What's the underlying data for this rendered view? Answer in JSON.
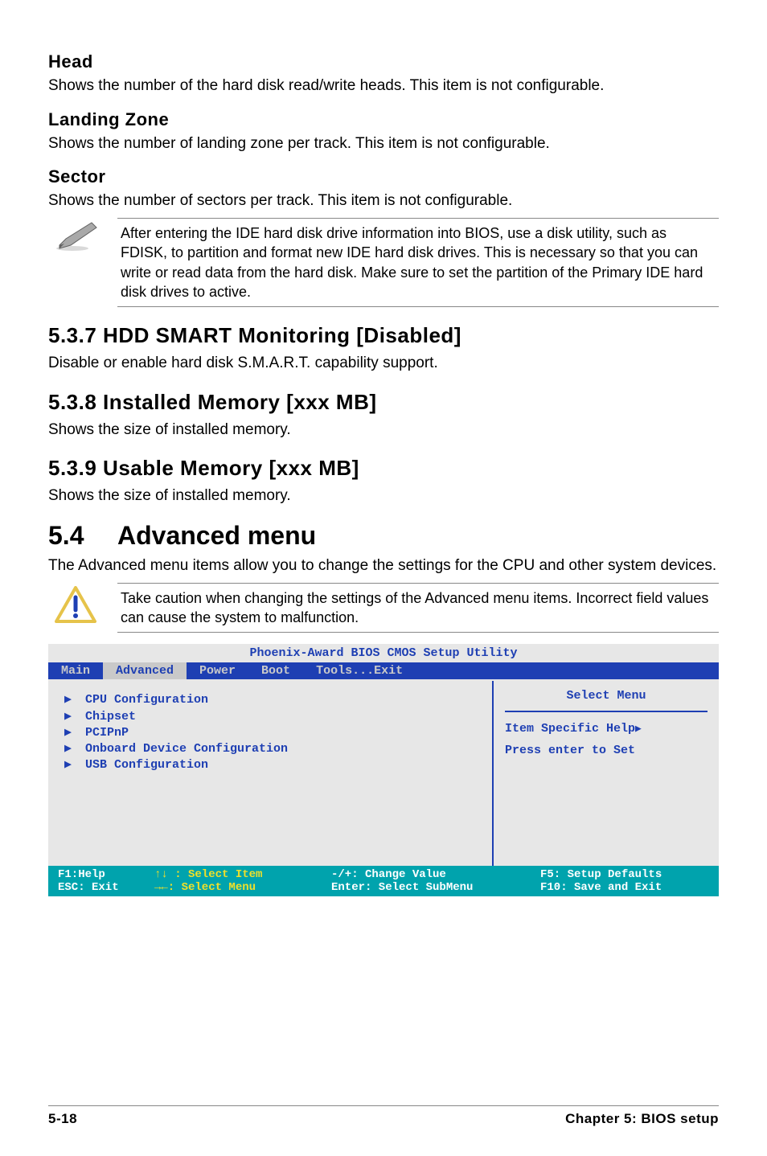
{
  "sections": {
    "head": {
      "title": "Head",
      "text": "Shows the number of the hard disk read/write heads. This item is not configurable."
    },
    "landing": {
      "title": "Landing Zone",
      "text": "Shows the number of landing zone per track. This item is not configurable."
    },
    "sector": {
      "title": "Sector",
      "text": "Shows the number of sectors per track. This item is not configurable."
    },
    "note1": "After entering the IDE hard disk drive information into BIOS, use a disk utility, such as FDISK, to partition and format new IDE hard disk drives. This is necessary so that you can write or read data from the hard disk. Make sure to set the partition of the Primary IDE hard disk drives to active.",
    "hdd": {
      "title": "5.3.7 HDD SMART Monitoring [Disabled]",
      "text": "Disable or enable hard disk S.M.A.R.T. capability support."
    },
    "installed": {
      "title": "5.3.8 Installed Memory [xxx MB]",
      "text": "Shows the size of installed memory."
    },
    "usable": {
      "title": "5.3.9 Usable Memory [xxx MB]",
      "text": "Shows the size of installed memory."
    },
    "advanced": {
      "num": "5.4",
      "title": "Advanced menu",
      "text": "The Advanced menu items allow you to change the settings for the CPU and other system devices."
    },
    "note2": "Take caution when changing the settings of the Advanced menu items. Incorrect field values can cause the system to malfunction."
  },
  "bios": {
    "title": "Phoenix-Award BIOS CMOS Setup Utility",
    "tabs": [
      "Main",
      "Advanced",
      "Power",
      "Boot",
      "Tools...Exit"
    ],
    "active_tab": "Advanced",
    "left_items": [
      "CPU Configuration",
      "Chipset",
      "PCIPnP",
      "Onboard Device Configuration",
      "USB Configuration"
    ],
    "right": {
      "title": "Select Menu",
      "line1": "Item Specific Help",
      "line2": "Press enter to Set"
    },
    "footer": {
      "r1c1": "F1:Help",
      "r1c2": "↑↓ : Select Item",
      "r1c3": "-/+: Change Value",
      "r1c4": "F5: Setup Defaults",
      "r2c1": "ESC: Exit",
      "r2c2": "→←: Select Menu",
      "r2c3": "Enter: Select SubMenu",
      "r2c4": "F10: Save and Exit"
    }
  },
  "footer": {
    "left": "5-18",
    "right": "Chapter 5: BIOS setup"
  }
}
